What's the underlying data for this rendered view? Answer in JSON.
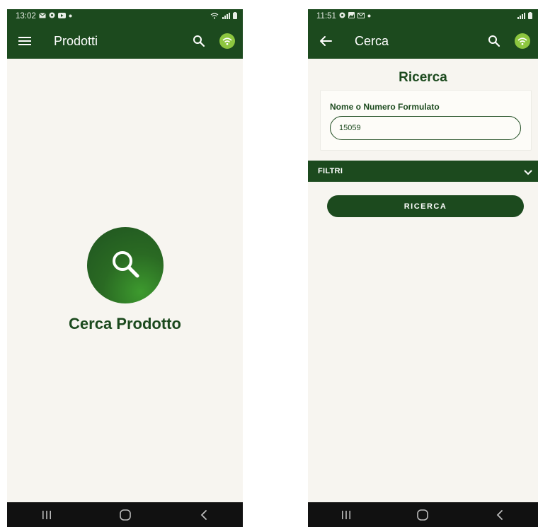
{
  "colors": {
    "primary": "#1c4a1e",
    "accent": "#8dc63f",
    "background": "#f7f5f0",
    "nav": "#111111"
  },
  "left_screen": {
    "status": {
      "time": "13:02",
      "icons": [
        "mail-icon",
        "circle-icon",
        "video-icon",
        "dot-icon"
      ],
      "right_icons": [
        "wifi-icon",
        "signal-icon",
        "battery-icon"
      ]
    },
    "app_bar": {
      "title": "Prodotti",
      "lead_icon": "menu-icon",
      "actions": [
        "search-icon",
        "wifi-badge-icon"
      ]
    },
    "main": {
      "title": "Cerca Prodotto",
      "icon": "search-icon"
    },
    "nav": [
      "recent-apps-icon",
      "home-icon",
      "back-icon"
    ]
  },
  "right_screen": {
    "status": {
      "time": "11:51",
      "icons": [
        "circle-icon",
        "photo-icon",
        "mail-icon",
        "dot-icon"
      ],
      "right_icons": [
        "signal-icon",
        "battery-icon"
      ]
    },
    "app_bar": {
      "title": "Cerca",
      "lead_icon": "back-arrow-icon",
      "actions": [
        "search-icon",
        "wifi-badge-icon"
      ]
    },
    "heading": "Ricerca",
    "form": {
      "label": "Nome o Numero Formulato",
      "value": "15059",
      "placeholder": ""
    },
    "filters": {
      "label": "FILTRI",
      "icon": "chevron-down-icon"
    },
    "search_button": "RICERCA",
    "nav": [
      "recent-apps-icon",
      "home-icon",
      "back-icon"
    ]
  }
}
